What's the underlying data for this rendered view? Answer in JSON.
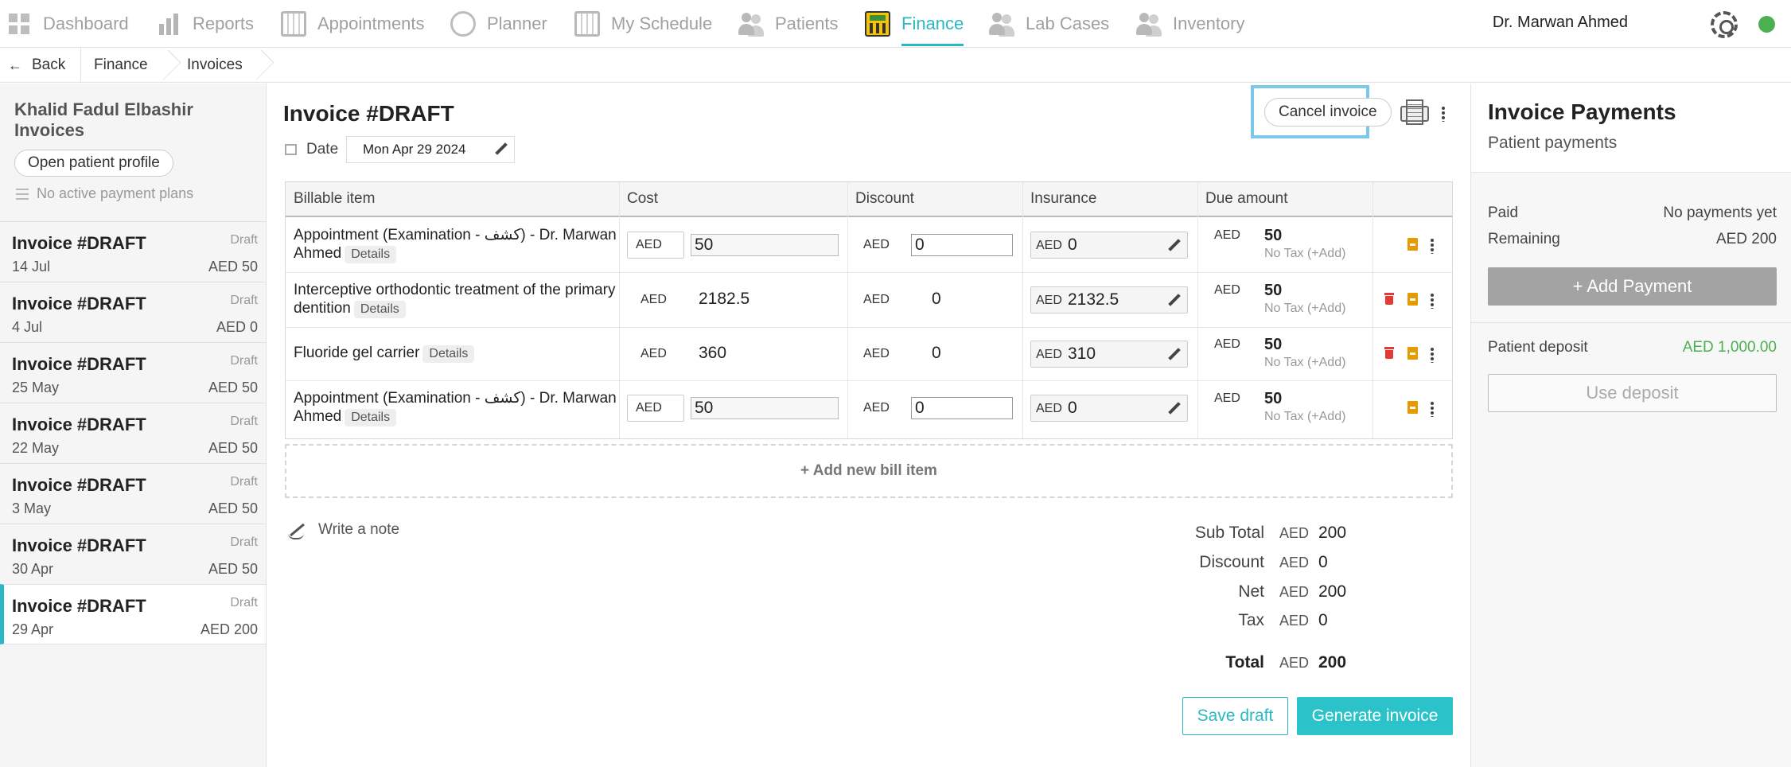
{
  "nav": {
    "items": [
      {
        "label": "Dashboard",
        "icon": "dashboard-icon"
      },
      {
        "label": "Reports",
        "icon": "reports-icon"
      },
      {
        "label": "Appointments",
        "icon": "appointments-icon"
      },
      {
        "label": "Planner",
        "icon": "planner-icon"
      },
      {
        "label": "My Schedule",
        "icon": "schedule-icon"
      },
      {
        "label": "Patients",
        "icon": "patients-icon"
      },
      {
        "label": "Finance",
        "icon": "finance-calculator-icon",
        "active": true
      },
      {
        "label": "Lab Cases",
        "icon": "lab-cases-icon"
      },
      {
        "label": "Inventory",
        "icon": "inventory-icon"
      }
    ],
    "user": "Dr. Marwan Ahmed",
    "accent_color": "#2bb8c4",
    "status_color": "#4caf50"
  },
  "breadcrumb": {
    "back": "Back",
    "items": [
      "Finance",
      "Invoices"
    ]
  },
  "sidebar": {
    "title": "Khalid Fadul Elbashir Invoices",
    "open_profile": "Open patient profile",
    "no_plans": "No active payment plans",
    "invoices": [
      {
        "title": "Invoice #DRAFT",
        "status": "Draft",
        "date": "14 Jul",
        "amount": "AED 50"
      },
      {
        "title": "Invoice #DRAFT",
        "status": "Draft",
        "date": "4 Jul",
        "amount": "AED 0"
      },
      {
        "title": "Invoice #DRAFT",
        "status": "Draft",
        "date": "25 May",
        "amount": "AED 50"
      },
      {
        "title": "Invoice #DRAFT",
        "status": "Draft",
        "date": "22 May",
        "amount": "AED 50"
      },
      {
        "title": "Invoice #DRAFT",
        "status": "Draft",
        "date": "3 May",
        "amount": "AED 50"
      },
      {
        "title": "Invoice #DRAFT",
        "status": "Draft",
        "date": "30 Apr",
        "amount": "AED 50"
      },
      {
        "title": "Invoice #DRAFT",
        "status": "Draft",
        "date": "29 Apr",
        "amount": "AED 200",
        "selected": true
      }
    ]
  },
  "invoice": {
    "title": "Invoice #DRAFT",
    "date_label": "Date",
    "date_value": "Mon Apr 29 2024",
    "cancel_label": "Cancel invoice",
    "columns": [
      "Billable item",
      "Cost",
      "Discount",
      "Insurance",
      "Due amount"
    ],
    "currency": "AED",
    "details_label": "Details",
    "rows": [
      {
        "item": "Appointment (Examination - كشف) - Dr. Marwan Ahmed",
        "cost": "50",
        "discount": "0",
        "insurance": "0",
        "due": "50",
        "tax": "No Tax (+Add)",
        "editable": true,
        "deletable": false
      },
      {
        "item": "Interceptive orthodontic treatment of the primary dentition",
        "cost": "2182.5",
        "discount": "0",
        "insurance": "2132.5",
        "due": "50",
        "tax": "No Tax (+Add)",
        "editable": false,
        "deletable": true
      },
      {
        "item": "Fluoride gel carrier",
        "cost": "360",
        "discount": "0",
        "insurance": "310",
        "due": "50",
        "tax": "No Tax (+Add)",
        "editable": false,
        "deletable": true
      },
      {
        "item": "Appointment (Examination - كشف) - Dr. Marwan Ahmed",
        "cost": "50",
        "discount": "0",
        "insurance": "0",
        "due": "50",
        "tax": "No Tax (+Add)",
        "editable": true,
        "deletable": false
      }
    ],
    "add_item": "+ Add new bill item",
    "note": "Write a note",
    "totals": [
      {
        "label": "Sub Total",
        "value": "200"
      },
      {
        "label": "Discount",
        "value": "0"
      },
      {
        "label": "Net",
        "value": "200"
      },
      {
        "label": "Tax",
        "value": "0"
      },
      {
        "label": "Total",
        "value": "200"
      }
    ],
    "save_draft": "Save draft",
    "generate": "Generate invoice"
  },
  "payments": {
    "title": "Invoice Payments",
    "subtitle": "Patient payments",
    "paid_label": "Paid",
    "paid_value": "No payments yet",
    "remaining_label": "Remaining",
    "remaining_value": "AED 200",
    "add_payment": "+ Add Payment",
    "deposit_label": "Patient deposit",
    "deposit_value": "AED 1,000.00",
    "use_deposit": "Use deposit"
  }
}
